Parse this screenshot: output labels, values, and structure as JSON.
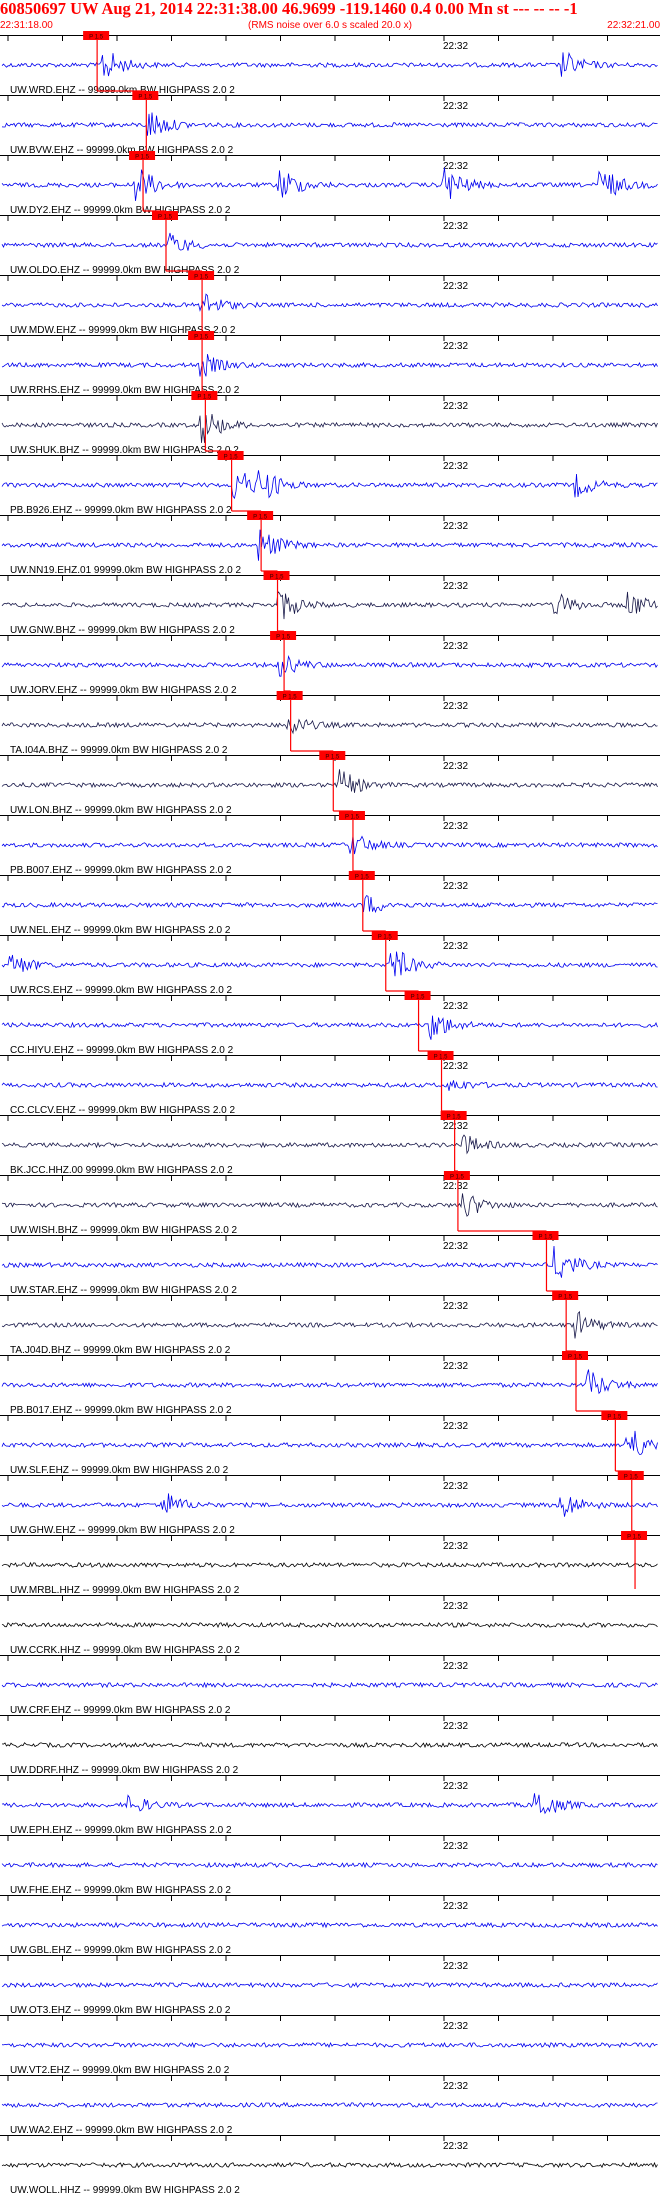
{
  "header": {
    "title": "60850697 UW Aug 21, 2014 22:31:38.00   46.9699 -119.1460  0.4 0.00 Mn st --- -- --   -1",
    "start_time": "22:31:18.00",
    "rms_note": "(RMS noise over 6.0 s scaled 20.0 x)",
    "end_time": "22:32:21.00"
  },
  "colors": {
    "header": "#ff0000",
    "trace_blue": "#0000ee",
    "trace_dark": "#1a1a4a",
    "trace_black": "#000000",
    "pick": "#ff0000"
  },
  "chart_data": {
    "type": "line",
    "title": "60850697 UW Aug 21, 2014 22:31:38.00   46.9699 -119.1460  0.4 0.00 Mn st --- -- --   -1",
    "time_start": "22:31:18.00",
    "time_end": "22:32:21.00",
    "center_tick_label": "22:32",
    "pick_tag": "P 1.5",
    "traces": [
      {
        "label": "UW.WRD.EHZ -- 99999.0km BW  HIGHPASS  2.0  2",
        "color": "blue",
        "pick_frac": 0.145,
        "events": [
          [
            0.16,
            0.9
          ],
          [
            0.86,
            0.7
          ]
        ]
      },
      {
        "label": "UW.BVW.EHZ -- 99999.0km BW  HIGHPASS  2.0  2",
        "color": "blue",
        "pick_frac": 0.22,
        "events": [
          [
            0.23,
            0.8
          ]
        ]
      },
      {
        "label": "UW.DY2.EHZ -- 99999.0km BW  HIGHPASS  2.0  2",
        "color": "blue",
        "pick_frac": 0.215,
        "events": [
          [
            0.21,
            1.0
          ],
          [
            0.43,
            0.9
          ],
          [
            0.68,
            1.0
          ],
          [
            0.92,
            0.9
          ]
        ]
      },
      {
        "label": "UW.OLDO.EHZ -- 99999.0km BW  HIGHPASS  2.0  2",
        "color": "blue",
        "pick_frac": 0.25,
        "events": [
          [
            0.26,
            0.6
          ]
        ]
      },
      {
        "label": "UW.MDW.EHZ -- 99999.0km BW  HIGHPASS  2.0  2",
        "color": "blue",
        "pick_frac": 0.305,
        "events": [
          [
            0.31,
            0.7
          ]
        ]
      },
      {
        "label": "UW.RRHS.EHZ -- 99999.0km BW  HIGHPASS  2.0  2",
        "color": "blue",
        "pick_frac": 0.305,
        "events": [
          [
            0.31,
            0.6
          ]
        ]
      },
      {
        "label": "UW.SHUK.BHZ -- 99999.0km BW  HIGHPASS  2.0  2",
        "color": "dark",
        "pick_frac": 0.31,
        "events": [
          [
            0.31,
            1.0
          ]
        ]
      },
      {
        "label": "PB.B926.EHZ -- 99999.0km BW  HIGHPASS  2.0  2",
        "color": "blue",
        "pick_frac": 0.35,
        "events": [
          [
            0.36,
            1.0
          ],
          [
            0.4,
            0.8
          ],
          [
            0.88,
            0.6
          ]
        ]
      },
      {
        "label": "UW.NN19.EHZ.01 99999.0km BW  HIGHPASS  2.0  2",
        "color": "blue",
        "pick_frac": 0.395,
        "events": [
          [
            0.4,
            0.9
          ]
        ]
      },
      {
        "label": "UW.GNW.BHZ -- 99999.0km BW  HIGHPASS  2.0  2",
        "color": "dark",
        "pick_frac": 0.42,
        "events": [
          [
            0.43,
            0.8
          ],
          [
            0.85,
            0.6
          ],
          [
            0.96,
            0.7
          ]
        ]
      },
      {
        "label": "UW.JORV.EHZ -- 99999.0km BW  HIGHPASS  2.0  2",
        "color": "blue",
        "pick_frac": 0.43,
        "events": [
          [
            0.43,
            0.6
          ]
        ]
      },
      {
        "label": "TA.I04A.BHZ -- 99999.0km BW  HIGHPASS  2.0  2",
        "color": "dark",
        "pick_frac": 0.44,
        "events": [
          [
            0.44,
            0.6
          ]
        ]
      },
      {
        "label": "UW.LON.BHZ -- 99999.0km BW  HIGHPASS  2.0  2",
        "color": "dark",
        "pick_frac": 0.505,
        "events": [
          [
            0.52,
            0.8
          ]
        ]
      },
      {
        "label": "PB.B007.EHZ -- 99999.0km BW  HIGHPASS  2.0  2",
        "color": "blue",
        "pick_frac": 0.535,
        "events": [
          [
            0.54,
            0.6
          ]
        ]
      },
      {
        "label": "UW.NEL.EHZ -- 99999.0km BW  HIGHPASS  2.0  2",
        "color": "blue",
        "pick_frac": 0.55,
        "events": [
          [
            0.56,
            0.5
          ]
        ]
      },
      {
        "label": "UW.RCS.EHZ -- 99999.0km BW  HIGHPASS  2.0  2",
        "color": "blue",
        "pick_frac": 0.585,
        "events": [
          [
            0.6,
            1.0
          ],
          [
            0.02,
            0.6
          ]
        ]
      },
      {
        "label": "CC.HIYU.EHZ -- 99999.0km BW  HIGHPASS  2.0  2",
        "color": "blue",
        "pick_frac": 0.635,
        "events": [
          [
            0.66,
            0.8
          ]
        ]
      },
      {
        "label": "CC.CLCV.EHZ -- 99999.0km BW  HIGHPASS  2.0  2",
        "color": "blue",
        "pick_frac": 0.67,
        "events": [
          [
            0.69,
            0.3
          ]
        ]
      },
      {
        "label": "BK.JCC.HHZ.00 99999.0km BW  HIGHPASS  2.0  2",
        "color": "dark",
        "pick_frac": 0.69,
        "events": [
          [
            0.71,
            0.5
          ]
        ]
      },
      {
        "label": "UW.WISH.BHZ -- 99999.0km BW  HIGHPASS  2.0  2",
        "color": "dark",
        "pick_frac": 0.695,
        "events": [
          [
            0.71,
            0.7
          ]
        ]
      },
      {
        "label": "UW.STAR.EHZ -- 99999.0km BW  HIGHPASS  2.0  2",
        "color": "blue",
        "pick_frac": 0.83,
        "events": [
          [
            0.85,
            1.0
          ]
        ]
      },
      {
        "label": "TA.J04D.BHZ -- 99999.0km BW  HIGHPASS  2.0  2",
        "color": "dark",
        "pick_frac": 0.86,
        "events": [
          [
            0.88,
            0.7
          ]
        ]
      },
      {
        "label": "PB.B017.EHZ -- 99999.0km BW  HIGHPASS  2.0  2",
        "color": "blue",
        "pick_frac": 0.875,
        "events": [
          [
            0.9,
            0.8
          ]
        ]
      },
      {
        "label": "UW.SLF.EHZ -- 99999.0km BW  HIGHPASS  2.0  2",
        "color": "blue",
        "pick_frac": 0.935,
        "events": [
          [
            0.96,
            1.0
          ]
        ]
      },
      {
        "label": "UW.GHW.EHZ -- 99999.0km BW  HIGHPASS  2.0  2",
        "color": "blue",
        "pick_frac": 0.96,
        "events": [
          [
            0.25,
            0.7
          ],
          [
            0.86,
            0.7
          ]
        ]
      },
      {
        "label": "UW.MRBL.HHZ -- 99999.0km BW  HIGHPASS  2.0  2",
        "color": "black",
        "pick_frac": 0.965,
        "events": []
      },
      {
        "label": "UW.CCRK.HHZ -- 99999.0km BW  HIGHPASS  2.0  2",
        "color": "black",
        "events": []
      },
      {
        "label": "UW.CRF.EHZ -- 99999.0km BW  HIGHPASS  2.0  2",
        "color": "blue",
        "events": []
      },
      {
        "label": "UW.DDRF.HHZ -- 99999.0km BW  HIGHPASS  2.0  2",
        "color": "black",
        "events": []
      },
      {
        "label": "UW.EPH.EHZ -- 99999.0km BW  HIGHPASS  2.0  2",
        "color": "blue",
        "events": [
          [
            0.2,
            0.5
          ],
          [
            0.82,
            0.9
          ]
        ]
      },
      {
        "label": "UW.FHE.EHZ -- 99999.0km BW  HIGHPASS  2.0  2",
        "color": "blue",
        "events": []
      },
      {
        "label": "UW.GBL.EHZ -- 99999.0km BW  HIGHPASS  2.0  2",
        "color": "blue",
        "events": []
      },
      {
        "label": "UW.OT3.EHZ -- 99999.0km BW  HIGHPASS  2.0  2",
        "color": "blue",
        "events": []
      },
      {
        "label": "UW.VT2.EHZ -- 99999.0km BW  HIGHPASS  2.0  2",
        "color": "blue",
        "events": []
      },
      {
        "label": "UW.WA2.EHZ -- 99999.0km BW  HIGHPASS  2.0  2",
        "color": "blue",
        "events": []
      },
      {
        "label": "UW.WOLL.HHZ -- 99999.0km BW  HIGHPASS  2.0  2",
        "color": "black",
        "events": []
      }
    ]
  }
}
